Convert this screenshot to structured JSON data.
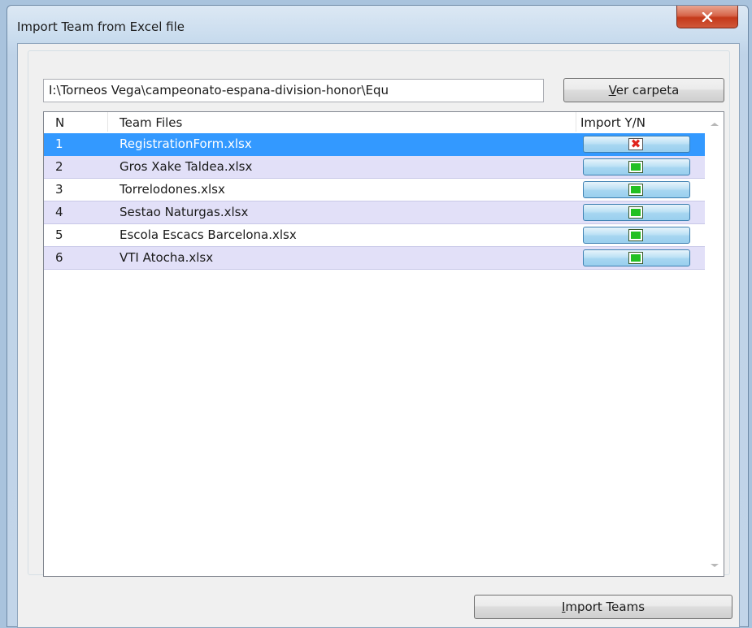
{
  "window": {
    "title": "Import Team from Excel file",
    "close_icon": "close-icon",
    "close_glyph": "✕"
  },
  "folder": {
    "path": "I:\\Torneos Vega\\campeonato-espana-division-honor\\Equ",
    "browse_button_first": "V",
    "browse_button_rest": "er carpeta"
  },
  "table": {
    "headers": {
      "n": "N",
      "files": "Team Files",
      "import": "Import Y/N"
    },
    "rows": [
      {
        "n": "1",
        "file": "RegistrationForm.xlsx",
        "import": false,
        "mark": "✖"
      },
      {
        "n": "2",
        "file": "Gros Xake Taldea.xlsx",
        "import": true,
        "mark": ""
      },
      {
        "n": "3",
        "file": "Torrelodones.xlsx",
        "import": true,
        "mark": ""
      },
      {
        "n": "4",
        "file": "Sestao Naturgas.xlsx",
        "import": true,
        "mark": ""
      },
      {
        "n": "5",
        "file": "Escola Escacs Barcelona.xlsx",
        "import": true,
        "mark": ""
      },
      {
        "n": "6",
        "file": "VTI Atocha.xlsx",
        "import": true,
        "mark": ""
      }
    ],
    "selected_row": 1
  },
  "actions": {
    "import_first": "I",
    "import_rest": "mport Teams"
  },
  "colors": {
    "selection": "#3399ff",
    "alt_row": "#e2e0f8",
    "checked": "#22c022",
    "unchecked": "#e0241c"
  }
}
